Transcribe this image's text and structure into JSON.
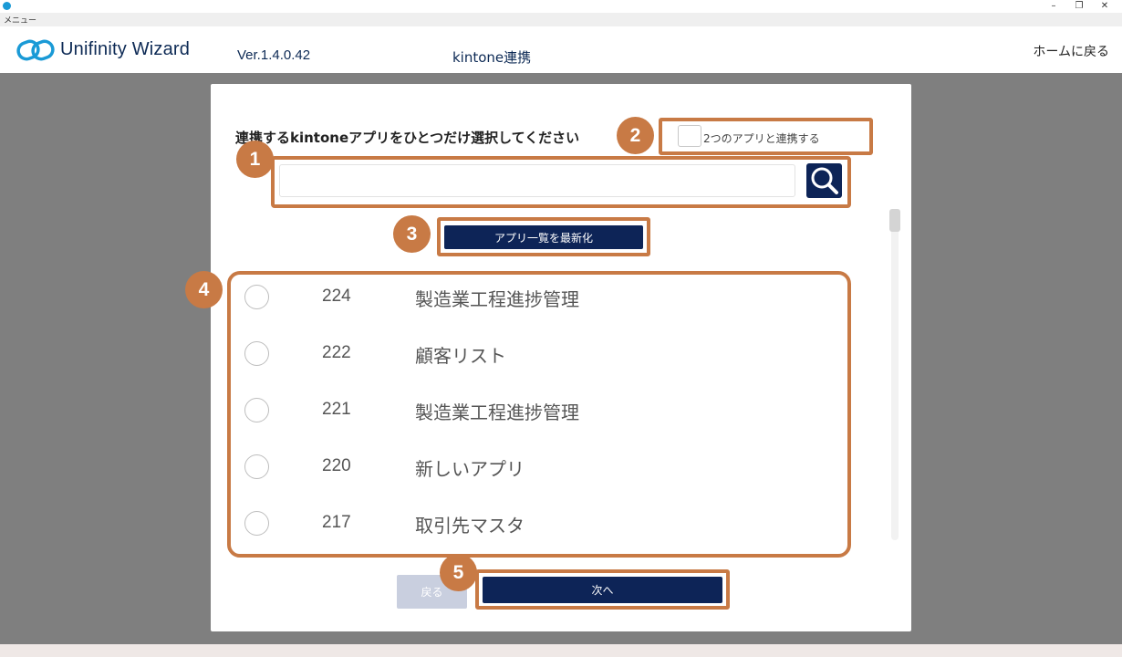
{
  "window": {
    "menu_label": "メニュー",
    "minimize": "–",
    "restore": "❐",
    "close": "✕"
  },
  "header": {
    "brand": "Unifinity Wizard",
    "version": "Ver.1.4.0.42",
    "page_title": "kintone連携",
    "home_link": "ホームに戻る"
  },
  "dialog": {
    "instruction": "連携するkintoneアプリをひとつだけ選択してください",
    "two_apps_label": "2つのアプリと連携する",
    "two_apps_checked": false,
    "search": {
      "value": "",
      "placeholder": ""
    },
    "refresh_label": "アプリ一覧を最新化",
    "apps": [
      {
        "id": "224",
        "name": "製造業工程進捗管理"
      },
      {
        "id": "222",
        "name": "顧客リスト"
      },
      {
        "id": "221",
        "name": "製造業工程進捗管理"
      },
      {
        "id": "220",
        "name": "新しいアプリ"
      },
      {
        "id": "217",
        "name": "取引先マスタ"
      }
    ],
    "back_label": "戻る",
    "next_label": "次へ"
  },
  "badges": [
    "1",
    "2",
    "3",
    "4",
    "5"
  ],
  "colors": {
    "accent": "#c87a45",
    "primary": "#0d2457",
    "disabled": "#c9cfdf",
    "brand": "#1a9ad6"
  }
}
